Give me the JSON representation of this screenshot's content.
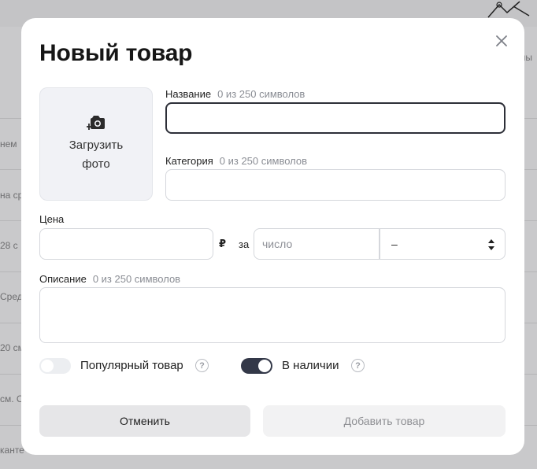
{
  "background": {
    "fragments": [
      "нем",
      "на ср",
      "28 с",
      "Средн",
      "20 см",
      "см. С",
      "канте"
    ],
    "right_fragment": "ны"
  },
  "modal": {
    "title": "Новый товар",
    "close_icon": "close-icon",
    "upload": {
      "icon": "camera-plus-icon",
      "label": "Загрузить фото"
    },
    "name": {
      "label": "Название",
      "hint": "0 из 250 символов",
      "value": ""
    },
    "category": {
      "label": "Категория",
      "hint": "0 из 250 символов",
      "value": ""
    },
    "price": {
      "label": "Цена",
      "value": "",
      "currency": "₽",
      "per": "за",
      "quantity_placeholder": "число",
      "unit_selected": "–"
    },
    "description": {
      "label": "Описание",
      "hint": "0 из 250 символов",
      "value": ""
    },
    "popular": {
      "label": "Популярный товар",
      "enabled": false
    },
    "in_stock": {
      "label": "В наличии",
      "enabled": true
    },
    "help_glyph": "?",
    "buttons": {
      "cancel": "Отменить",
      "add": "Добавить товар"
    },
    "colors": {
      "toggle_on": "#333848",
      "focus_border": "#2d2f38"
    }
  }
}
